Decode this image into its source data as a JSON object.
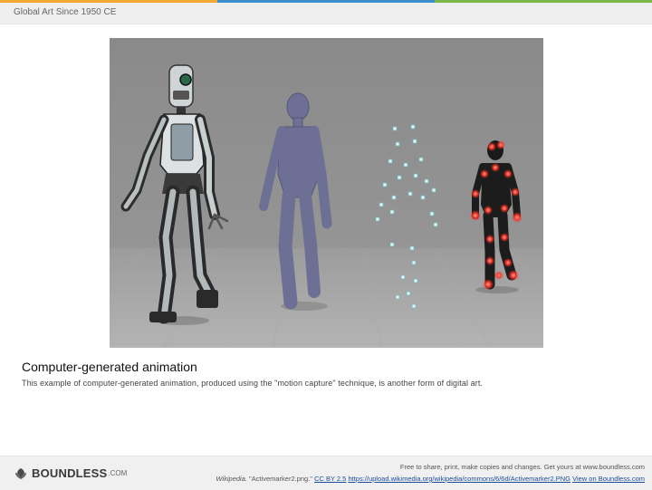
{
  "header": {
    "title": "Global Art Since 1950 CE",
    "strip_colors": [
      "#f0a830",
      "#3b8fcb",
      "#7ab648"
    ]
  },
  "figure": {
    "image_name": "motion-capture-animation",
    "background_color": "#8d8d8d"
  },
  "caption": {
    "title": "Computer-generated animation",
    "text": "This example of computer-generated animation, produced using the \"motion capture\" technique, is another form of digital art."
  },
  "footer": {
    "logo_icon": "boundless-leaf-icon",
    "logo_text": "BOUNDLESS",
    "logo_suffix": ".COM",
    "line1": "Free to share, print, make copies and changes. Get yours at www.boundless.com",
    "source": "Wikipedia.",
    "attribution": " \"Activemarker2.png.\" ",
    "license_link": "CC BY 2.5",
    "url_link": "https://upload.wikimedia.org/wikipedia/commons/6/6d/Activemarker2.PNG",
    "view_link": "View on Boundless.com",
    "link_color": "#1a4c9c"
  }
}
